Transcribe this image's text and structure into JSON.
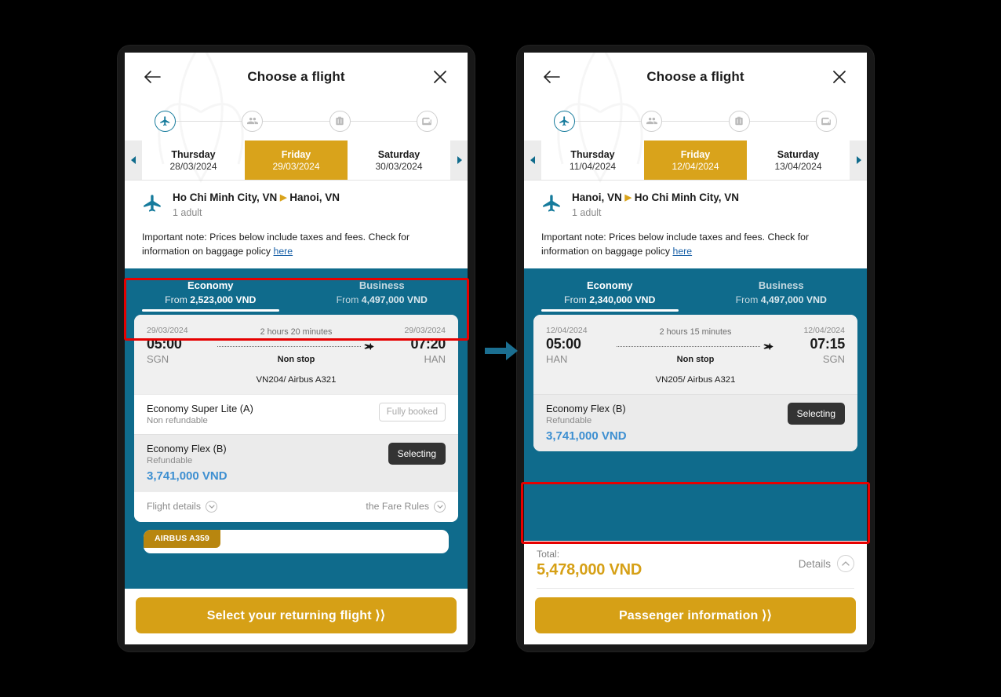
{
  "meta": {
    "accent_teal": "#0f6b8c",
    "accent_gold": "#d6a016",
    "price_blue": "#3d8fd1",
    "highlight_red": "#e60000",
    "arrow_color": "#1b6f91"
  },
  "transition_arrow": {
    "icon": "arrow-right-icon"
  },
  "screens": [
    {
      "id": "outbound",
      "header": {
        "back_icon": "back-arrow-icon",
        "title": "Choose a flight",
        "close_icon": "close-icon"
      },
      "stepper": [
        {
          "icon": "plane-icon",
          "state": "active"
        },
        {
          "icon": "passengers-icon",
          "state": "inactive"
        },
        {
          "icon": "baggage-icon",
          "state": "inactive"
        },
        {
          "icon": "payment-icon",
          "state": "inactive"
        }
      ],
      "date_strip": {
        "prev_icon": "chevron-left-icon",
        "next_icon": "chevron-right-icon",
        "days": [
          {
            "dow": "Thursday",
            "date": "28/03/2024",
            "selected": false
          },
          {
            "dow": "Friday",
            "date": "29/03/2024",
            "selected": true
          },
          {
            "dow": "Saturday",
            "date": "30/03/2024",
            "selected": false
          }
        ]
      },
      "route": {
        "plane_icon": "plane-icon",
        "origin": "Ho Chi Minh City, VN",
        "separator": "▶",
        "destination": "Hanoi, VN",
        "passengers": "1 adult"
      },
      "note": {
        "text": "Important note: Prices below include taxes and fees. Check for information on baggage policy ",
        "link": "here"
      },
      "cabin_tabs": [
        {
          "name": "Economy",
          "from_label": "From ",
          "from_price": "2,523,000 VND",
          "active": true
        },
        {
          "name": "Business",
          "from_label": "From ",
          "from_price": "4,497,000 VND",
          "active": false
        }
      ],
      "flight": {
        "depart_date": "29/03/2024",
        "depart_time": "05:00",
        "depart_code": "SGN",
        "duration": "2 hours 20 minutes",
        "stops": "Non stop",
        "arrive_date": "29/03/2024",
        "arrive_time": "07:20",
        "arrive_code": "HAN",
        "flight_no": "VN204/ Airbus A321"
      },
      "fares": [
        {
          "name": "Economy Super Lite (A)",
          "refund": "Non refundable",
          "price": "",
          "action_type": "badge",
          "action_label": "Fully booked"
        },
        {
          "name": "Economy Flex (B)",
          "refund": "Refundable",
          "price": "3,741,000 VND",
          "action_type": "button",
          "action_label": "Selecting"
        }
      ],
      "card_footer": {
        "details_label": "Flight details",
        "details_icon": "chevron-down-circle-icon",
        "rules_label": "the Fare Rules",
        "rules_icon": "chevron-down-circle-icon"
      },
      "peek_card": {
        "tag": "AIRBUS A359"
      },
      "cta": {
        "label": "Select your returning flight ⟩⟩"
      },
      "highlight": "cabin-tabs"
    },
    {
      "id": "return",
      "header": {
        "back_icon": "back-arrow-icon",
        "title": "Choose a flight",
        "close_icon": "close-icon"
      },
      "stepper": [
        {
          "icon": "plane-icon",
          "state": "active"
        },
        {
          "icon": "passengers-icon",
          "state": "inactive"
        },
        {
          "icon": "baggage-icon",
          "state": "inactive"
        },
        {
          "icon": "payment-icon",
          "state": "inactive"
        }
      ],
      "date_strip": {
        "prev_icon": "chevron-left-icon",
        "next_icon": "chevron-right-icon",
        "days": [
          {
            "dow": "Thursday",
            "date": "11/04/2024",
            "selected": false
          },
          {
            "dow": "Friday",
            "date": "12/04/2024",
            "selected": true
          },
          {
            "dow": "Saturday",
            "date": "13/04/2024",
            "selected": false
          }
        ]
      },
      "route": {
        "plane_icon": "plane-icon",
        "origin": "Hanoi, VN",
        "separator": "▶",
        "destination": "Ho Chi Minh City, VN",
        "passengers": "1 adult"
      },
      "note": {
        "text": "Important note: Prices below include taxes and fees. Check for information on baggage policy ",
        "link": "here"
      },
      "cabin_tabs": [
        {
          "name": "Economy",
          "from_label": "From ",
          "from_price": "2,340,000 VND",
          "active": true
        },
        {
          "name": "Business",
          "from_label": "From ",
          "from_price": "4,497,000 VND",
          "active": false
        }
      ],
      "flight": {
        "depart_date": "12/04/2024",
        "depart_time": "05:00",
        "depart_code": "HAN",
        "duration": "2 hours 15 minutes",
        "stops": "Non stop",
        "arrive_date": "12/04/2024",
        "arrive_time": "07:15",
        "arrive_code": "SGN",
        "flight_no": "VN205/ Airbus A321"
      },
      "fares": [
        {
          "name": "Economy Flex (B)",
          "refund": "Refundable",
          "price": "3,741,000 VND",
          "action_type": "button",
          "action_label": "Selecting"
        }
      ],
      "total": {
        "label": "Total:",
        "amount": "5,478,000 VND",
        "details_label": "Details",
        "details_icon": "chevron-up-circle-icon"
      },
      "cta": {
        "label": "Passenger information ⟩⟩"
      },
      "highlight": "selected-fare-row"
    }
  ]
}
